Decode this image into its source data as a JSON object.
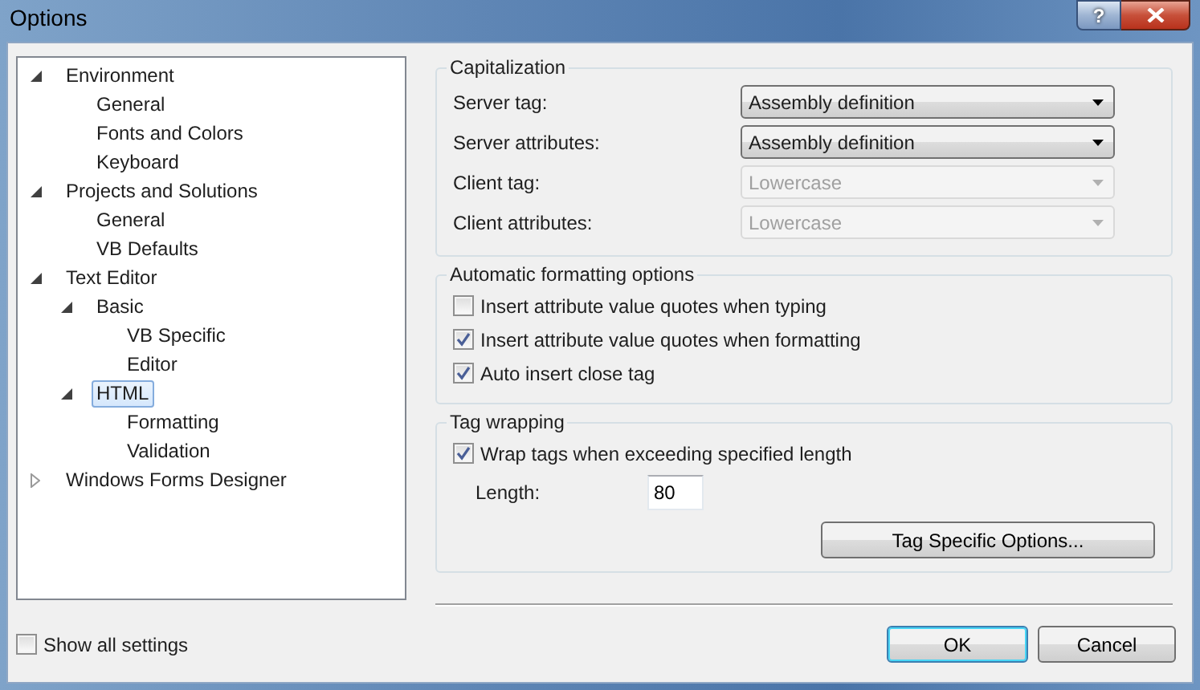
{
  "window": {
    "title": "Options",
    "help_button": "?"
  },
  "tree": {
    "items": [
      {
        "label": "Environment",
        "expanded": true,
        "selected": false,
        "children": [
          {
            "label": "General",
            "selected": false
          },
          {
            "label": "Fonts and Colors",
            "selected": false
          },
          {
            "label": "Keyboard",
            "selected": false
          }
        ]
      },
      {
        "label": "Projects and Solutions",
        "expanded": true,
        "selected": false,
        "children": [
          {
            "label": "General",
            "selected": false
          },
          {
            "label": "VB Defaults",
            "selected": false
          }
        ]
      },
      {
        "label": "Text Editor",
        "expanded": true,
        "selected": false,
        "children": [
          {
            "label": "Basic",
            "expanded": true,
            "selected": false,
            "children": [
              {
                "label": "VB Specific",
                "selected": false
              },
              {
                "label": "Editor",
                "selected": false
              }
            ]
          },
          {
            "label": "HTML",
            "expanded": true,
            "selected": true,
            "children": [
              {
                "label": "Formatting",
                "selected": false
              },
              {
                "label": "Validation",
                "selected": false
              }
            ]
          }
        ]
      },
      {
        "label": "Windows Forms Designer",
        "expanded": false,
        "selected": false
      }
    ]
  },
  "capitalization": {
    "title": "Capitalization",
    "fields": [
      {
        "label": "Server tag:",
        "value": "Assembly definition",
        "disabled": false
      },
      {
        "label": "Server attributes:",
        "value": "Assembly definition",
        "disabled": false
      },
      {
        "label": "Client tag:",
        "value": "Lowercase",
        "disabled": true
      },
      {
        "label": "Client attributes:",
        "value": "Lowercase",
        "disabled": true
      }
    ]
  },
  "formatting": {
    "title": "Automatic formatting options",
    "options": [
      {
        "label": "Insert attribute value quotes when typing",
        "checked": false
      },
      {
        "label": "Insert attribute value quotes when formatting",
        "checked": true
      },
      {
        "label": "Auto insert close tag",
        "checked": true
      }
    ]
  },
  "tag_wrapping": {
    "title": "Tag wrapping",
    "options": [
      {
        "label": "Wrap tags when exceeding specified length",
        "checked": true
      }
    ],
    "length": {
      "label": "Length:",
      "value": "80"
    },
    "button": "Tag Specific Options..."
  },
  "footer": {
    "show_all": {
      "label": "Show all settings",
      "checked": false
    },
    "buttons": [
      {
        "label": "OK",
        "default": true
      },
      {
        "label": "Cancel",
        "default": false
      }
    ]
  }
}
